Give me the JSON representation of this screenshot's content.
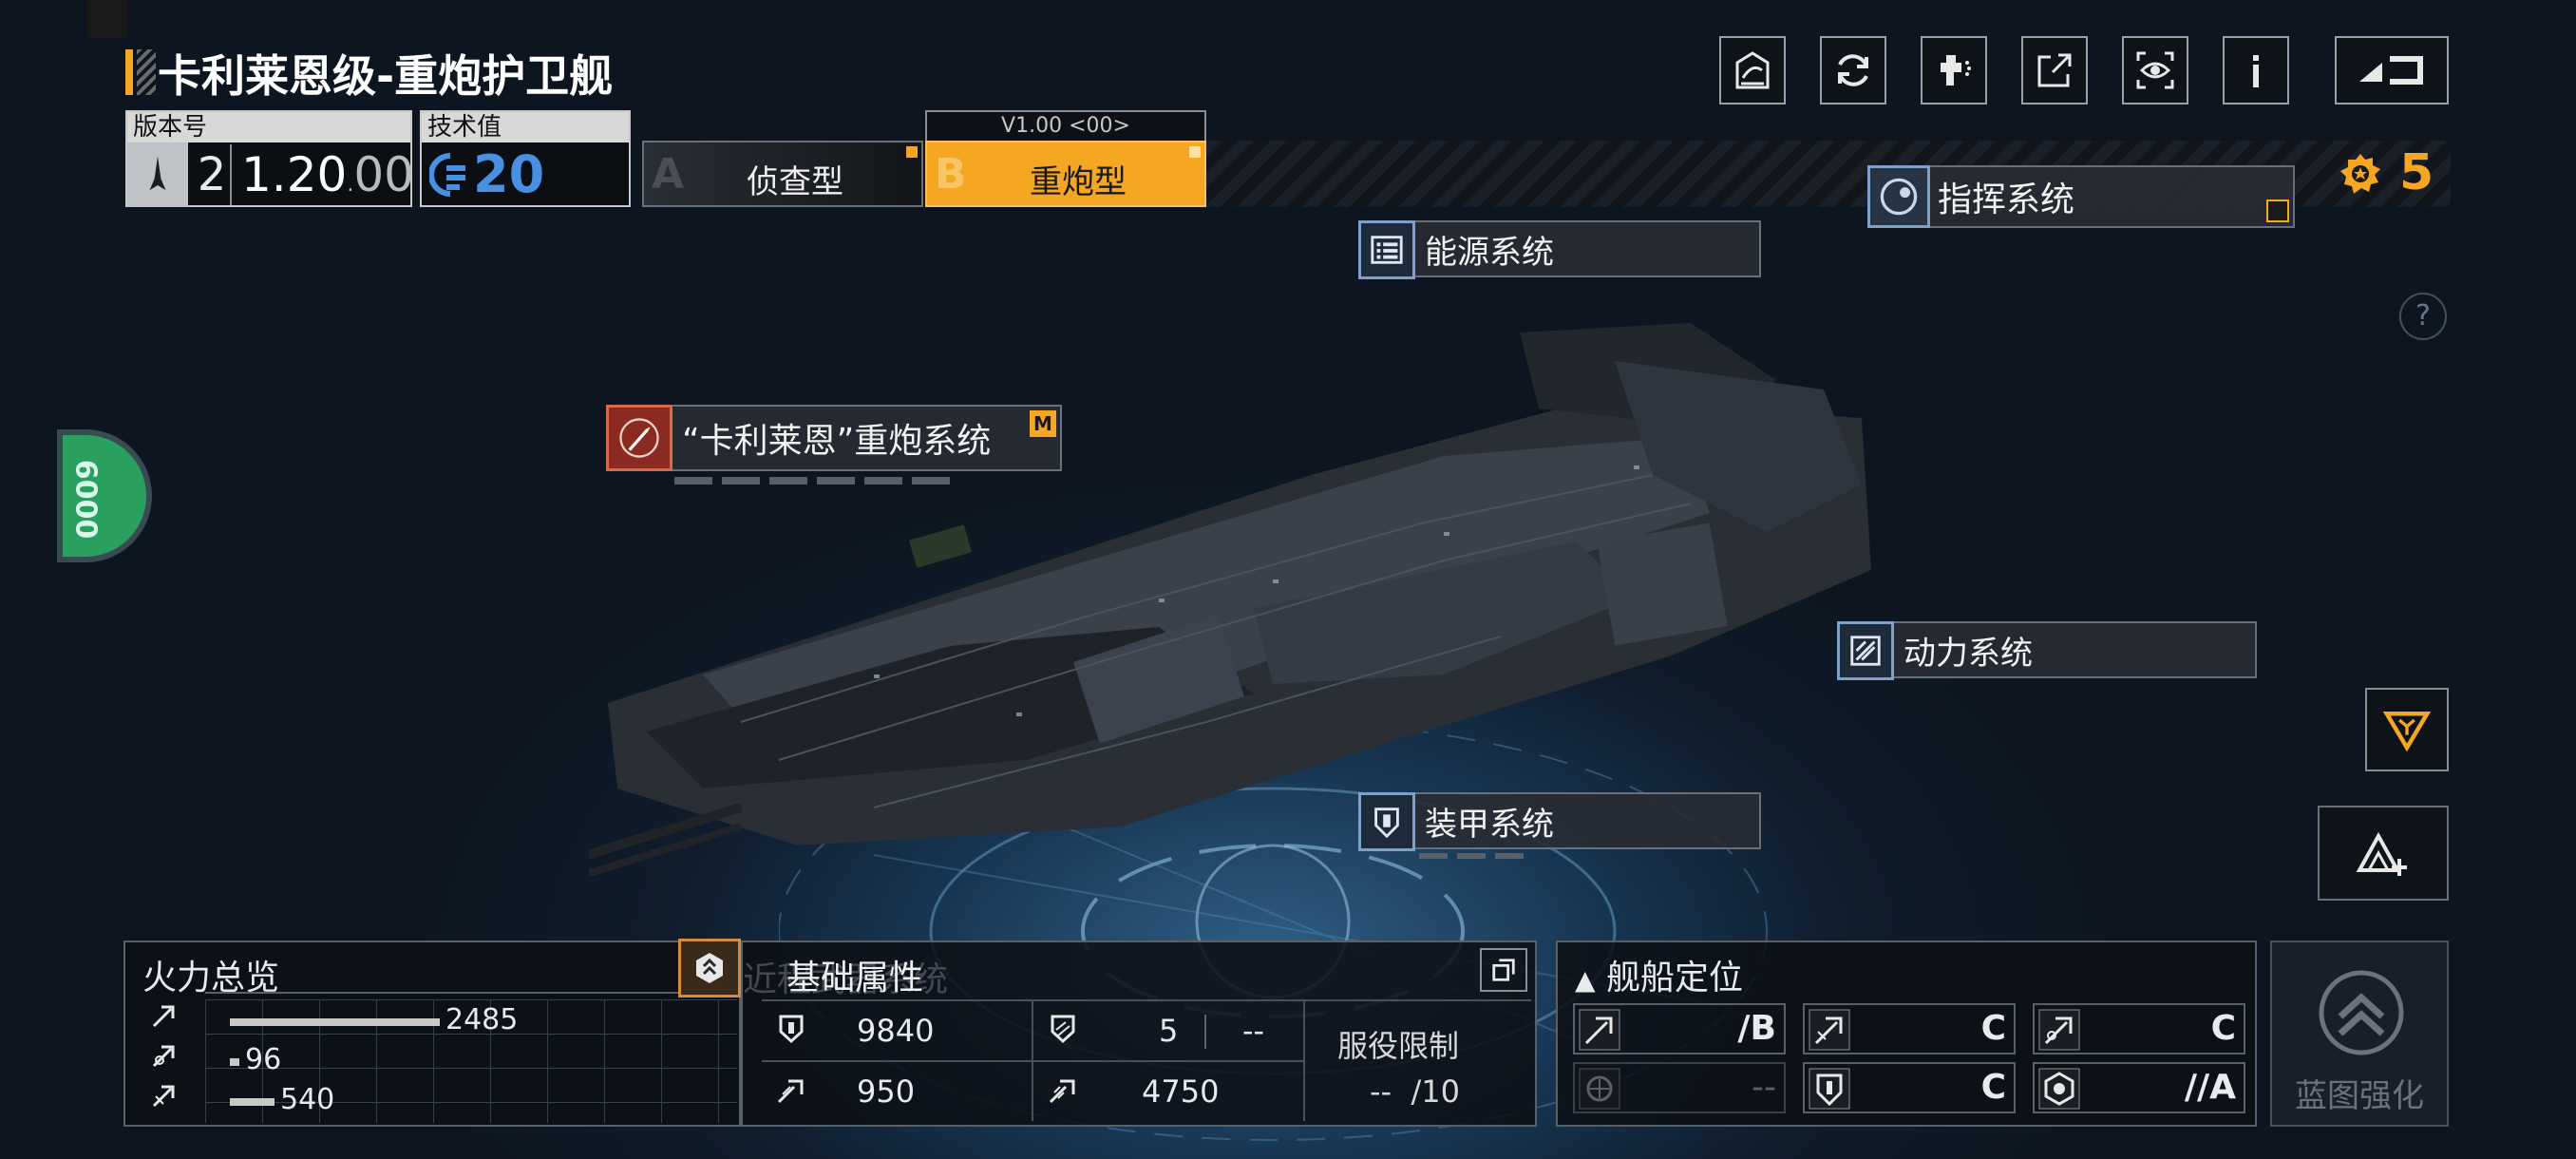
{
  "ship": {
    "name": "卡利莱恩级-重炮护卫舰",
    "version_label": "版本号",
    "version_num": "2",
    "version_value": "1.20",
    "version_sub": "00",
    "tech_label": "技术值",
    "tech_value": "20"
  },
  "variants": {
    "a_letter": "A",
    "a_label": "侦查型",
    "b_letter": "B",
    "b_label": "重炮型",
    "b_version": "V1.00 <00>"
  },
  "command": {
    "label": "指挥系统",
    "points": "5"
  },
  "systems": {
    "energy": "能源系统",
    "cannon": "“卡利莱恩”重炮系统",
    "cannon_badge": "M",
    "power": "动力系统",
    "armor": "装甲系统"
  },
  "side": {
    "badge_text": "6000",
    "help": "?"
  },
  "firepower": {
    "title": "火力总览",
    "rows": [
      {
        "value": "2485",
        "fraction": 0.85
      },
      {
        "value": "96",
        "fraction": 0.03
      },
      {
        "value": "540",
        "fraction": 0.18
      }
    ]
  },
  "base_attrs": {
    "title": "基础属性",
    "ghost": "近程武器系统",
    "hp": "9840",
    "armor_slots": "5",
    "armor_dash": "--",
    "speed": "950",
    "range": "4750",
    "service_label": "服役限制",
    "service_value": "--",
    "service_max": "/10"
  },
  "positioning": {
    "title": "舰船定位",
    "grades": [
      "/B",
      "C",
      "C",
      "--",
      "C",
      "//A"
    ]
  },
  "blueprint": {
    "label": "蓝图强化"
  },
  "colors": {
    "accent": "#f5a623",
    "blue": "#4a90e2",
    "panel_border": "#5a6068"
  },
  "icons": [
    "share-icon",
    "refresh-icon",
    "paint-icon",
    "export-icon",
    "view-icon",
    "info-icon",
    "back-icon"
  ]
}
